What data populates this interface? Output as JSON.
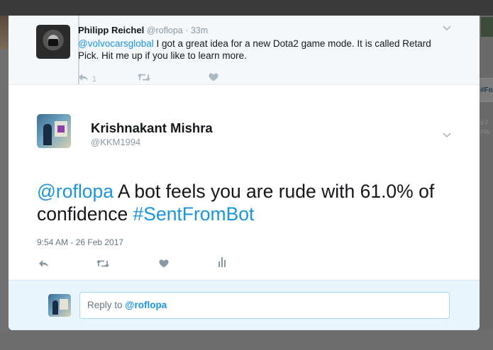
{
  "background": {
    "right_tag": "#Fo",
    "right_small_1": "p 2",
    "right_small_2": "Priv"
  },
  "parent_tweet": {
    "name": "Philipp Reichel",
    "handle": "@roflopa",
    "separator": " · ",
    "time": "33m",
    "mention": "@volvocarsglobal",
    "text": " I got a great idea for a new Dota2 game mode. It is called Retard Pick. Hit me up if you like to learn more.",
    "reply_count": "1",
    "icons": [
      "reply-icon",
      "retweet-icon",
      "like-icon",
      "more-caret-icon"
    ]
  },
  "main_tweet": {
    "name": "Krishnakant Mishra",
    "handle": "@KKM1994",
    "mention": "@roflopa",
    "text": " A bot feels you are rude with 61.0% of confidence ",
    "hashtag": "#SentFromBot",
    "timestamp": "9:54 AM - 26 Feb 2017",
    "icons": [
      "reply-icon",
      "retweet-icon",
      "like-icon",
      "analytics-icon",
      "more-caret-icon"
    ]
  },
  "reply": {
    "prefix": "Reply to ",
    "mention": "@roflopa"
  },
  "colors": {
    "link": "#1b95e0",
    "text": "#14171a",
    "muted": "#8899a6",
    "reply_bar": "#e8f5fd",
    "parent_bg": "#f5f8fa"
  }
}
